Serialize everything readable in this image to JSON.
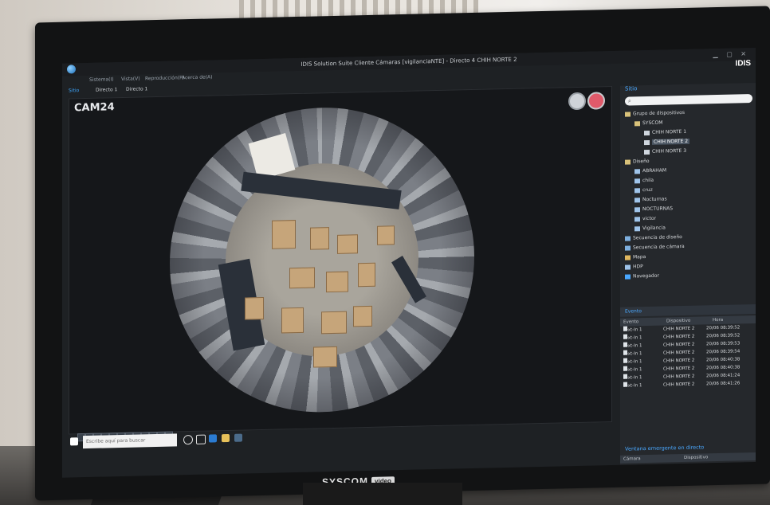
{
  "window": {
    "title": "IDIS Solution Suite Cliente Cámaras [vigilanciaNTE] - Directo 4  CHIH NORTE 2",
    "brand": "IDIS"
  },
  "menu": [
    "Sistema(I)",
    "Vista(V)",
    "Reproducción(P)",
    "Acerca de(A)"
  ],
  "tabs": [
    {
      "label": "Sitio",
      "active": true
    },
    {
      "label": "Directo 1",
      "active": false
    },
    {
      "label": "Directo 1",
      "active": false
    }
  ],
  "video": {
    "camera_label": "CAM24"
  },
  "taskbar": {
    "search_placeholder": "Escribe aquí para buscar"
  },
  "site_panel": {
    "title": "Sitio",
    "tree": [
      {
        "label": "Grupo de dispositivos",
        "level": 0,
        "icon": "folder-icon"
      },
      {
        "label": "SYSCOM",
        "level": 1,
        "icon": "folder-icon"
      },
      {
        "label": "CHIH NORTE 1",
        "level": 2,
        "icon": "recorder-icon"
      },
      {
        "label": "CHIH NORTE 2",
        "level": 2,
        "icon": "recorder-icon",
        "selected": true
      },
      {
        "label": "CHIH NORTE 3",
        "level": 2,
        "icon": "recorder-icon"
      },
      {
        "label": "Diseño",
        "level": 0,
        "icon": "folder-icon"
      },
      {
        "label": "ABRAHAM",
        "level": 1,
        "icon": "layout-icon"
      },
      {
        "label": "chila",
        "level": 1,
        "icon": "layout-icon"
      },
      {
        "label": "cruz",
        "level": 1,
        "icon": "layout-icon"
      },
      {
        "label": "Nocturnas",
        "level": 1,
        "icon": "layout-icon"
      },
      {
        "label": "NOCTURNAS",
        "level": 1,
        "icon": "layout-icon"
      },
      {
        "label": "victor",
        "level": 1,
        "icon": "layout-icon"
      },
      {
        "label": "Vigilancia",
        "level": 1,
        "icon": "layout-icon"
      },
      {
        "label": "Secuencia de diseño",
        "level": 0,
        "icon": "sequence-icon"
      },
      {
        "label": "Secuencia de cámara",
        "level": 0,
        "icon": "sequence-icon"
      },
      {
        "label": "Mapa",
        "level": 0,
        "icon": "map-icon"
      },
      {
        "label": "HDP",
        "level": 0,
        "icon": "hdp-icon"
      },
      {
        "label": "Navegador",
        "level": 0,
        "icon": "browser-icon"
      }
    ]
  },
  "events": {
    "title": "Evento",
    "columns": [
      "Evento",
      "Dispositivo",
      "Hora"
    ],
    "rows": [
      [
        "Text-In 1",
        "CHIH NORTE 2",
        "20/06 08:39:52"
      ],
      [
        "Text-In 1",
        "CHIH NORTE 2",
        "20/06 08:39:52"
      ],
      [
        "Text-In 1",
        "CHIH NORTE 2",
        "20/06 08:39:53"
      ],
      [
        "Text-In 1",
        "CHIH NORTE 2",
        "20/06 08:39:54"
      ],
      [
        "Text-In 1",
        "CHIH NORTE 2",
        "20/06 08:40:38"
      ],
      [
        "Text-In 1",
        "CHIH NORTE 2",
        "20/06 08:40:38"
      ],
      [
        "Text-In 1",
        "CHIH NORTE 2",
        "20/06 08:41:24"
      ],
      [
        "Text-In 1",
        "CHIH NORTE 2",
        "20/06 08:41:26"
      ]
    ]
  },
  "popup": {
    "title": "Ventana emergente en directo",
    "columns": [
      "Cámara",
      "Dispositivo"
    ]
  },
  "bezel": {
    "brand": "SYSCOM",
    "sub": "video"
  }
}
